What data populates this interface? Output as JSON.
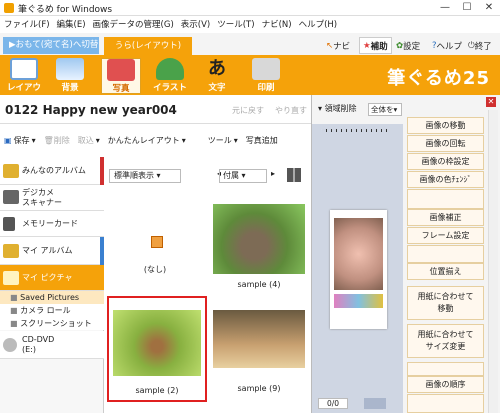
{
  "window": {
    "title": "筆ぐるめ for Windows"
  },
  "menu": [
    "ファイル(F)",
    "編集(E)",
    "画像データの管理(G)",
    "表示(V)",
    "ツール(T)",
    "ナビ(N)",
    "ヘルプ(H)"
  ],
  "tabs": {
    "prev": "おもて(宛て名)へ切替",
    "active": "うら(レイアウト)",
    "navi": "ナビ",
    "assist": "補助",
    "settings": "設定",
    "help": "ヘルプ",
    "exit": "終了"
  },
  "toolbar": {
    "tools": [
      "レイアウト",
      "背景",
      "写真",
      "イラスト",
      "文字",
      "印刷"
    ],
    "brand": "筆ぐるめ25"
  },
  "doc": {
    "title": "0122  Happy new year004",
    "undo": "元に戻す",
    "redo": "やり直す"
  },
  "actions": {
    "save": "保存",
    "delete": "削除",
    "import": "取込",
    "easy_layout": "かんたんレイアウト",
    "tools": "ツール",
    "add_photo": "写真追加"
  },
  "sidebar": {
    "items": [
      "みんなのアルバム",
      "デジカメ\nスキャナー",
      "メモリーカード",
      "マイ アルバム",
      "マイ ピクチャ"
    ],
    "subitems": [
      "Saved Pictures",
      "カメラ ロール",
      "スクリーンショット"
    ],
    "cd": "CD-DVD\n(E:)"
  },
  "gallery": {
    "sort": "標準順表示",
    "date": "付属",
    "cells": [
      "(なし)",
      "sample (4)",
      "sample (2)",
      "sample (9)"
    ]
  },
  "preview": {
    "area_delete": "領域削除",
    "show_all": "全体を",
    "page": "0/0"
  },
  "right_panel": {
    "buttons": [
      "画像の移動",
      "画像の回転",
      "画像の枠設定",
      "画像の色ﾁｪﾝｼﾞ",
      "画像補正",
      "フレーム設定",
      "位置揃え",
      "用紙に合わせて\n移動",
      "用紙に合わせて\nサイズ変更",
      "画像の順序"
    ]
  },
  "colors": {
    "orange": "#f5a20a",
    "blue_tab": "#7bb6ea",
    "selection": "#e02020"
  }
}
